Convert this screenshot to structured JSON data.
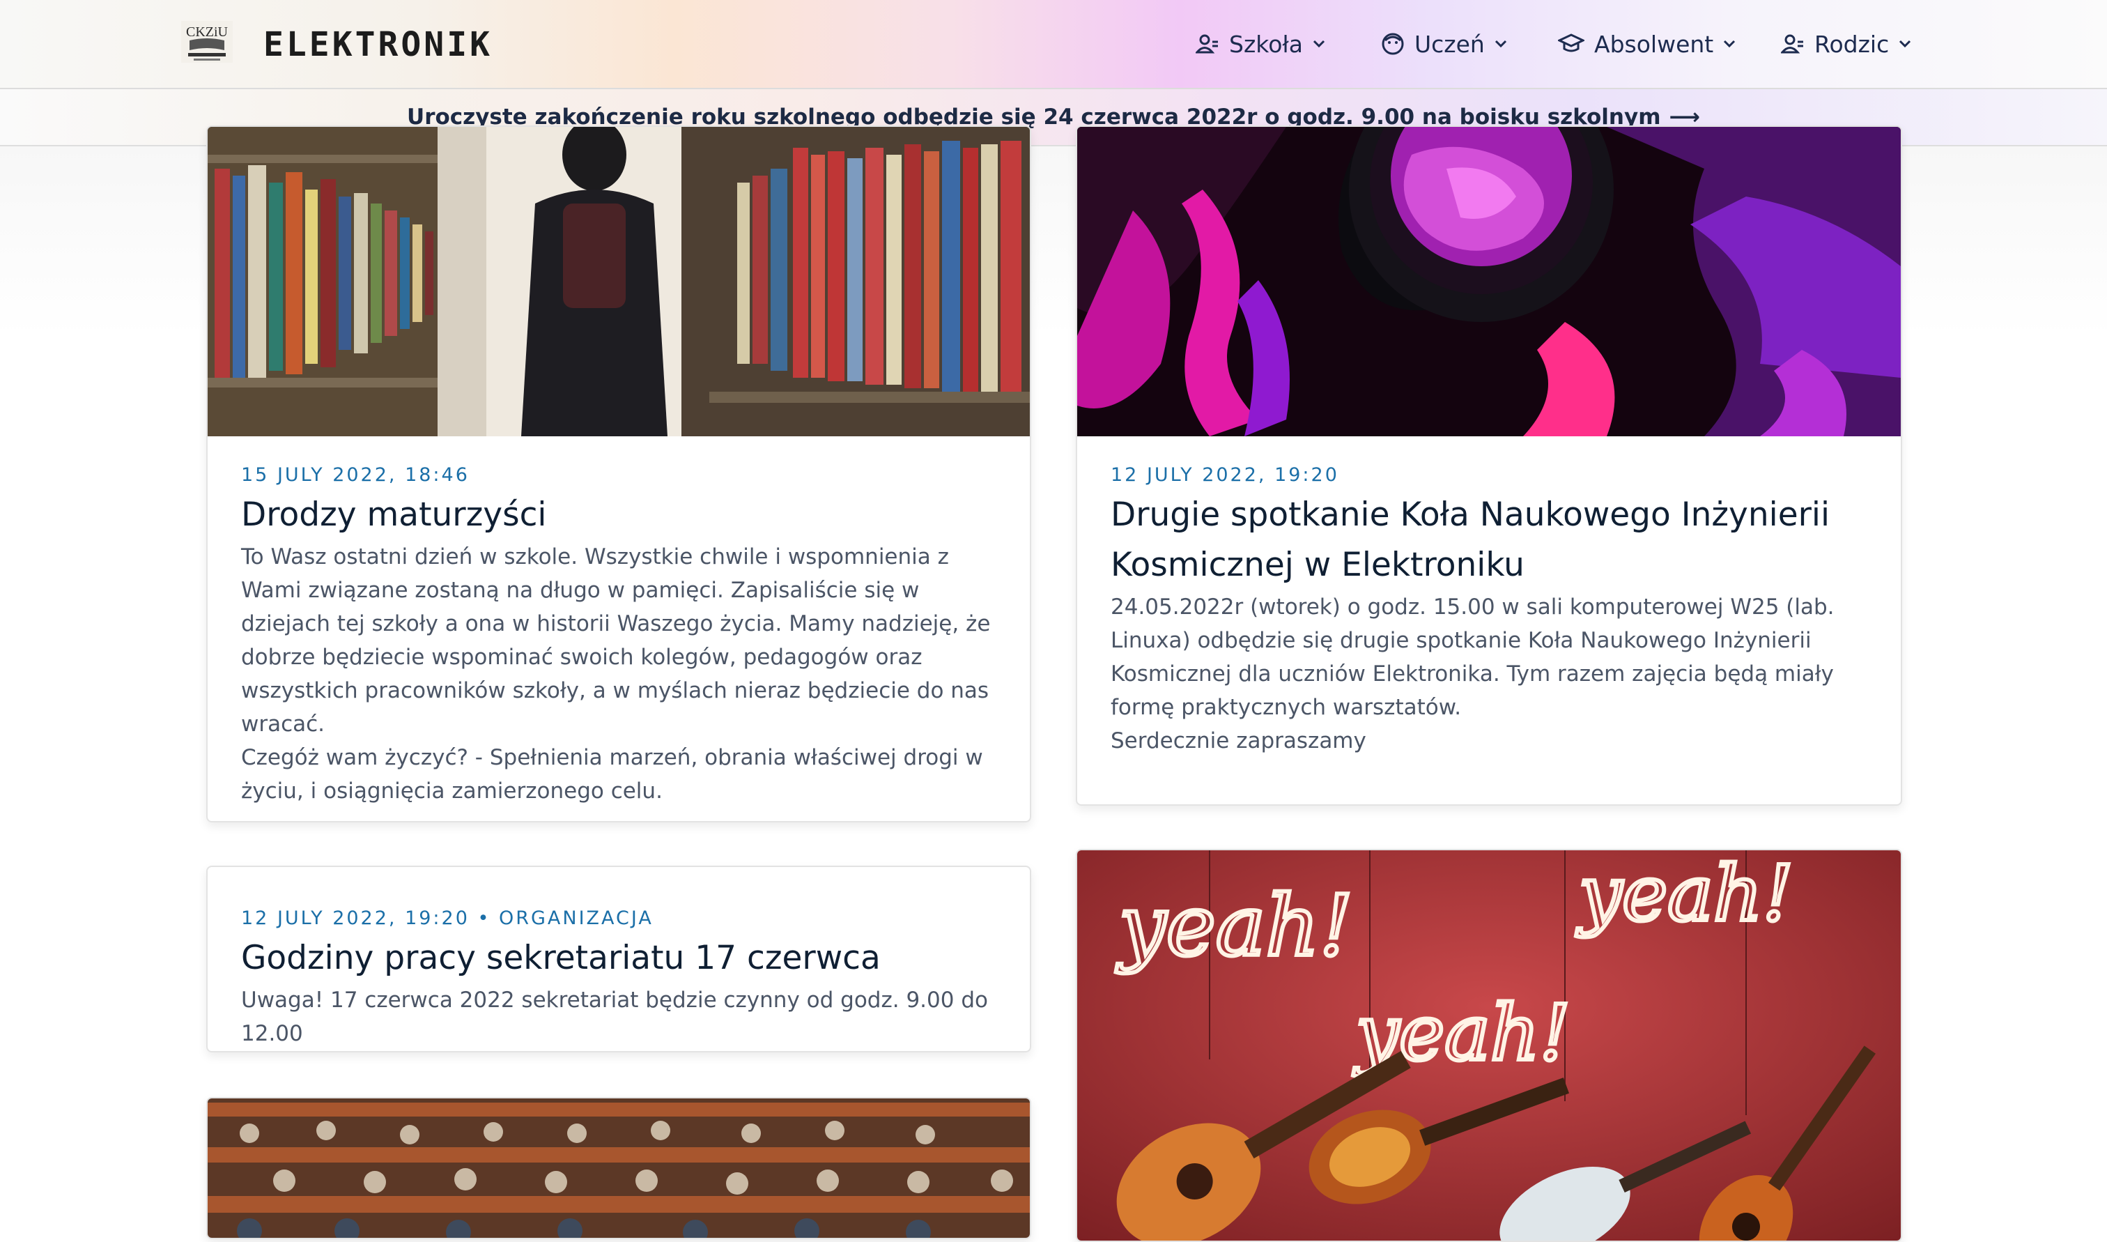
{
  "header": {
    "brand": "ELEKTRONIK",
    "logo_text": "CKZiU",
    "nav": [
      {
        "label": "Szkoła",
        "icon": "users-icon"
      },
      {
        "label": "Uczeń",
        "icon": "face-icon"
      },
      {
        "label": "Absolwent",
        "icon": "graduation-cap-icon"
      },
      {
        "label": "Rodzic",
        "icon": "user-icon"
      }
    ]
  },
  "banner": {
    "text": "Uroczyste zakończenie roku szkolnego odbędzie się 24 czerwca 2022r o godz. 9.00 na boisku szkolnym",
    "arrow": "⟶"
  },
  "posts": [
    {
      "meta": "15 JULY 2022, 18:46",
      "title": "Drodzy maturzyści",
      "body": [
        "To Wasz ostatni dzień w szkole. Wszystkie chwile i wspomnienia z Wami związane zostaną na długo w pamięci. Zapisaliście się w dziejach tej szkoły a ona w historii Waszego życia. Mamy nadzieję, że dobrze będziecie wspominać swoich kolegów, pedagogów oraz wszystkich pracowników szkoły, a w myślach nieraz będziecie do nas wracać.",
        "Czegóż wam życzyć? - Spełnienia marzeń, obrania właściwej drogi w życiu, i osiągnięcia zamierzonego celu."
      ]
    },
    {
      "meta": "12 JULY 2022, 19:20",
      "title": "Drugie spotkanie Koła Naukowego Inżynierii Kosmicznej w Elektroniku",
      "body": [
        "24.05.2022r (wtorek) o godz. 15.00 w sali komputerowej W25 (lab. Linuxa) odbędzie się drugie spotkanie Koła Naukowego Inżynierii Kosmicznej dla uczniów Elektronika. Tym razem zajęcia będą miały formę praktycznych warsztatów.",
        "Serdecznie zapraszamy"
      ]
    },
    {
      "meta": "12 JULY 2022, 19:20 • ORGANIZACJA",
      "title": "Godziny pracy sekretariatu 17 czerwca",
      "body": [
        "Uwaga! 17 czerwca 2022 sekretariat będzie czynny od godz. 9.00 do 12.00"
      ]
    }
  ],
  "neon": {
    "words": [
      "yeah!",
      "yeah!",
      "yeah!"
    ]
  }
}
